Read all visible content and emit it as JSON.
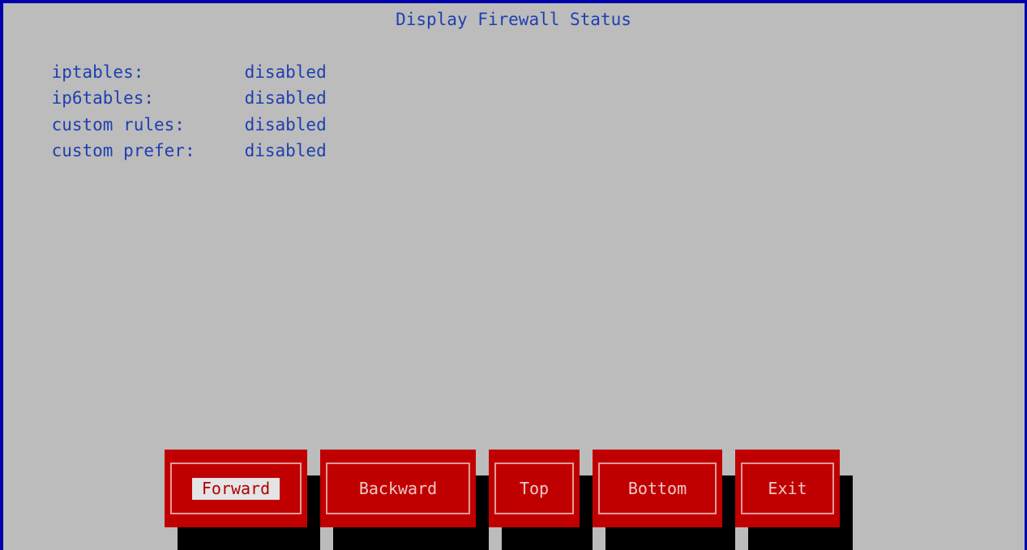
{
  "dialog": {
    "title": "Display Firewall Status"
  },
  "status": [
    {
      "key": "iptables:",
      "value": "disabled"
    },
    {
      "key": "ip6tables:",
      "value": "disabled"
    },
    {
      "key": "custom rules:",
      "value": "disabled"
    },
    {
      "key": "custom prefer:",
      "value": "disabled"
    }
  ],
  "buttons": {
    "forward": "Forward",
    "backward": "Backward",
    "top": "Top",
    "bottom": "Bottom",
    "exit": "Exit"
  },
  "colors": {
    "background": "#bcbcbc",
    "frame": "#0000aa",
    "text": "#1f3fb0",
    "button": "#c00000",
    "shadow": "#000000",
    "focus_highlight": "#e4e4e4"
  }
}
